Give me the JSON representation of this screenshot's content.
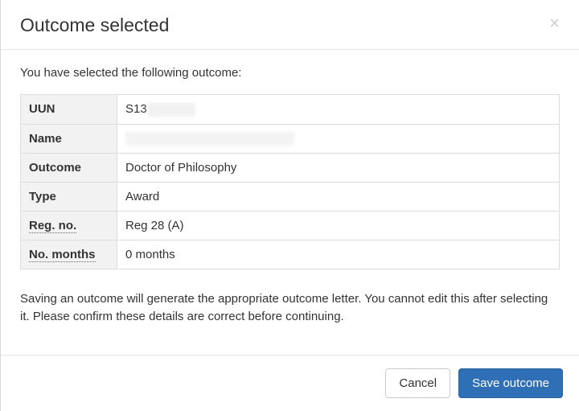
{
  "modal": {
    "title": "Outcome selected",
    "intro": "You have selected the following outcome:",
    "warning": "Saving an outcome will generate the appropriate outcome letter. You cannot edit this after selecting it. Please confirm these details are correct before continuing."
  },
  "details": {
    "labels": {
      "uun": "UUN",
      "name": "Name",
      "outcome": "Outcome",
      "type": "Type",
      "regno": "Reg. no.",
      "months": "No. months"
    },
    "values": {
      "uun_prefix": "S13",
      "uun_hidden": "XXXXXX",
      "name_hidden": "XXXXXXXXXXXXXXXXXXXXX",
      "outcome": "Doctor of Philosophy",
      "type": "Award",
      "regno": "Reg 28 (A)",
      "months": "0 months"
    }
  },
  "footer": {
    "cancel": "Cancel",
    "save": "Save outcome"
  }
}
